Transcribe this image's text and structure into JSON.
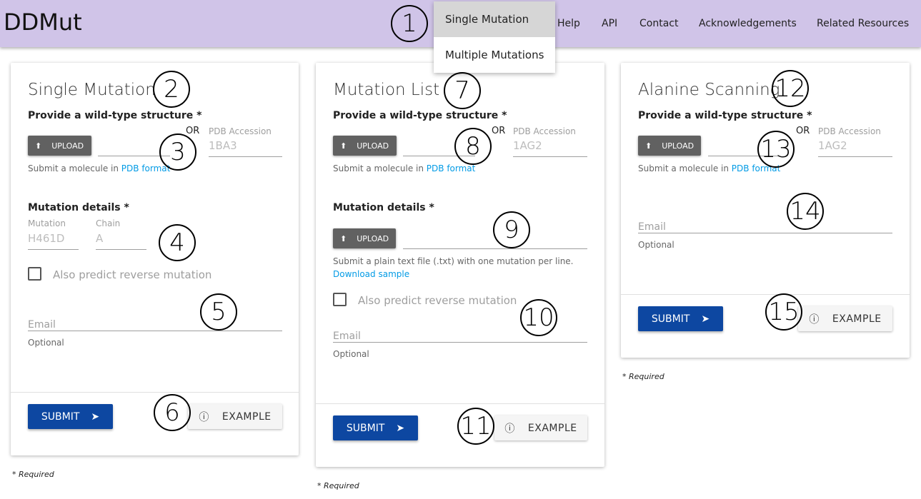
{
  "header": {
    "logo": "DDMut",
    "nav": [
      "Help",
      "API",
      "Contact",
      "Acknowledgements",
      "Related Resources"
    ],
    "dropdown": [
      "Single Mutation",
      "Multiple Mutations"
    ]
  },
  "cards": [
    {
      "title": "Single Mutation",
      "structure_label": "Provide a wild-type structure *",
      "upload": "UPLOAD",
      "or": "OR",
      "pdb_label": "PDB Accession",
      "pdb_placeholder": "1BA3",
      "hint": "Submit a molecule in ",
      "hint_link": "PDB format",
      "mutation_label": "Mutation details *",
      "mutation_field": "Mutation",
      "mutation_placeholder": "H461D",
      "chain_field": "Chain",
      "chain_placeholder": "A",
      "reverse": "Also predict reverse mutation",
      "email": "Email",
      "optional": "Optional",
      "submit": "SUBMIT",
      "example": "EXAMPLE",
      "required": "* Required"
    },
    {
      "title": "Mutation List",
      "structure_label": "Provide a wild-type structure *",
      "upload": "UPLOAD",
      "or": "OR",
      "pdb_label": "PDB Accession",
      "pdb_placeholder": "1AG2",
      "hint": "Submit a molecule in ",
      "hint_link": "PDB format",
      "mutation_label": "Mutation details *",
      "upload2": "UPLOAD",
      "file_hint": "Submit a plain text file (.txt) with one mutation per line.",
      "download": "Download sample",
      "reverse": "Also predict reverse mutation",
      "email": "Email",
      "optional": "Optional",
      "submit": "SUBMIT",
      "example": "EXAMPLE",
      "required": "* Required"
    },
    {
      "title": "Alanine Scanning",
      "structure_label": "Provide a wild-type structure *",
      "upload": "UPLOAD",
      "or": "OR",
      "pdb_label": "PDB Accession",
      "pdb_placeholder": "1AG2",
      "hint": "Submit a molecule in ",
      "hint_link": "PDB format",
      "email": "Email",
      "optional": "Optional",
      "submit": "SUBMIT",
      "example": "EXAMPLE",
      "required": "* Required"
    }
  ],
  "annotations": [
    "1",
    "2",
    "3",
    "4",
    "5",
    "6",
    "7",
    "8",
    "9",
    "10",
    "11",
    "12",
    "13",
    "14",
    "15"
  ]
}
